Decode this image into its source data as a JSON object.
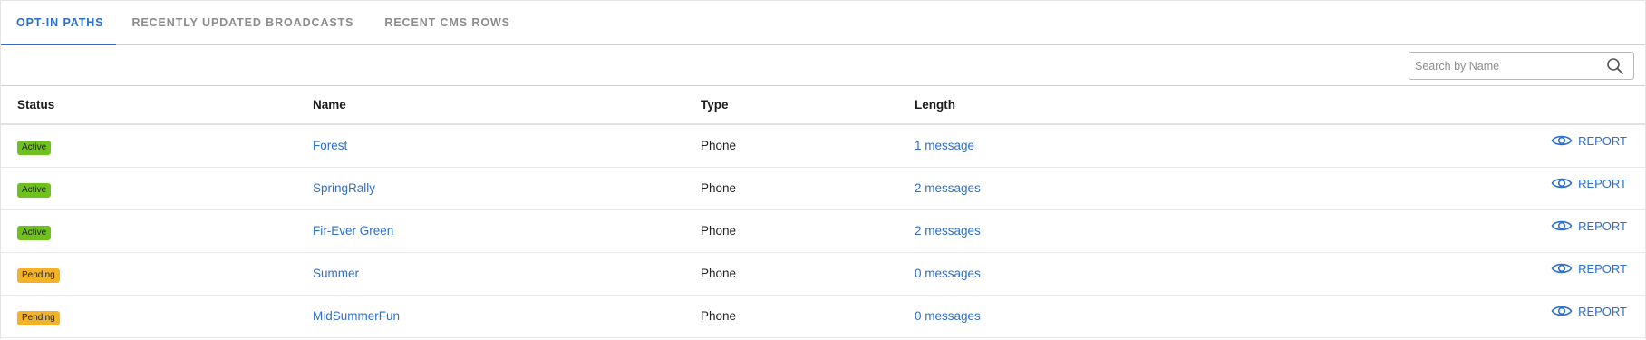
{
  "tabs": [
    {
      "label": "OPT-IN PATHS",
      "active": true
    },
    {
      "label": "RECENTLY UPDATED BROADCASTS",
      "active": false
    },
    {
      "label": "RECENT CMS ROWS",
      "active": false
    }
  ],
  "search": {
    "placeholder": "Search by Name",
    "value": "",
    "icon": "search-icon"
  },
  "table": {
    "headers": {
      "status": "Status",
      "name": "Name",
      "type": "Type",
      "length": "Length"
    },
    "rows": [
      {
        "status": "Active",
        "status_kind": "active",
        "name": "Forest",
        "type": "Phone",
        "length": "1 message",
        "action": "REPORT"
      },
      {
        "status": "Active",
        "status_kind": "active",
        "name": "SpringRally",
        "type": "Phone",
        "length": "2 messages",
        "action": "REPORT"
      },
      {
        "status": "Active",
        "status_kind": "active",
        "name": "Fir-Ever Green",
        "type": "Phone",
        "length": "2 messages",
        "action": "REPORT"
      },
      {
        "status": "Pending",
        "status_kind": "pending",
        "name": "Summer",
        "type": "Phone",
        "length": "0 messages",
        "action": "REPORT"
      },
      {
        "status": "Pending",
        "status_kind": "pending",
        "name": "MidSummerFun",
        "type": "Phone",
        "length": "0 messages",
        "action": "REPORT"
      }
    ]
  },
  "colors": {
    "accent": "#2a6fca",
    "active_badge": "#6fc21d",
    "pending_badge": "#f4b229",
    "muted_tab": "#8c8c8c"
  }
}
